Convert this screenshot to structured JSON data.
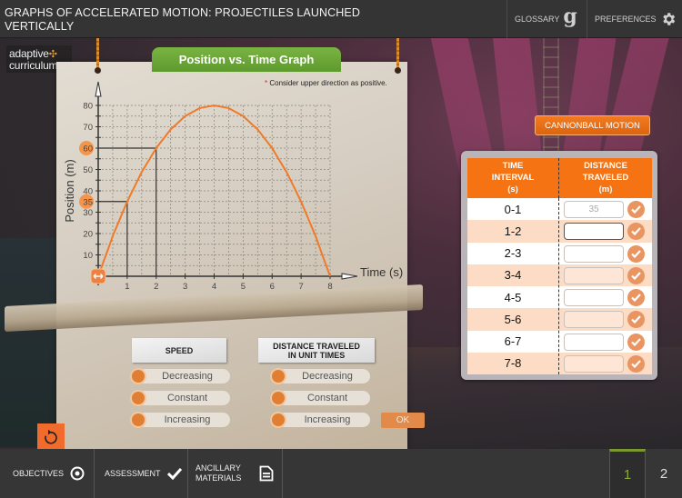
{
  "header": {
    "title_line1": "GRAPHS OF ACCELERATED MOTION: PROJECTILES LAUNCHED",
    "title_line2": "VERTICALLY",
    "glossary_label": "GLOSSARY",
    "glossary_glyph": "g",
    "preferences_label": "PREFERENCES"
  },
  "logo": {
    "line1": "adaptive",
    "line2": "curriculum"
  },
  "graph": {
    "banner": "Position vs. Time Graph",
    "note_star": "*",
    "note": "Consider upper direction as positive.",
    "highlighted_values": [
      "60",
      "35"
    ]
  },
  "chart_data": {
    "type": "line",
    "title": "Position vs. Time Graph",
    "xlabel": "Time (s)",
    "ylabel": "Position (m)",
    "xlim": [
      0,
      8
    ],
    "ylim": [
      0,
      80
    ],
    "x_ticks": [
      "1",
      "2",
      "3",
      "4",
      "5",
      "6",
      "7",
      "8"
    ],
    "y_ticks": [
      "10",
      "20",
      "30",
      "40",
      "50",
      "60",
      "70",
      "80"
    ],
    "grid": true,
    "series": [
      {
        "name": "position",
        "color": "#f07a28",
        "x": [
          0,
          0.5,
          1,
          1.5,
          2,
          2.5,
          3,
          3.5,
          4,
          4.5,
          5,
          5.5,
          6,
          6.5,
          7,
          7.5,
          8
        ],
        "y": [
          0,
          18.75,
          35,
          48.75,
          60,
          68.75,
          75,
          78.75,
          80,
          78.75,
          75,
          68.75,
          60,
          48.75,
          35,
          18.75,
          0
        ]
      }
    ],
    "guide_lines": [
      {
        "x": 1,
        "y": 35
      },
      {
        "x": 2,
        "y": 60
      }
    ]
  },
  "controls": {
    "cannonball_button": "CANNONBALL MOTION",
    "speed_tag": "SPEED",
    "distance_tag_line1": "DISTANCE TRAVELED",
    "distance_tag_line2": "IN UNIT TIMES",
    "speed_options": [
      "Decreasing",
      "Constant",
      "Increasing"
    ],
    "distance_options": [
      "Decreasing",
      "Constant",
      "Increasing"
    ],
    "ok_button": "OK"
  },
  "table": {
    "col1_line1": "TIME",
    "col1_line2": "INTERVAL",
    "col1_line3": "(s)",
    "col2_line1": "DISTANCE",
    "col2_line2": "TRAVELED",
    "col2_line3": "(m)",
    "rows": [
      {
        "interval": "0-1",
        "value": "35"
      },
      {
        "interval": "1-2",
        "value": ""
      },
      {
        "interval": "2-3",
        "value": ""
      },
      {
        "interval": "3-4",
        "value": ""
      },
      {
        "interval": "4-5",
        "value": ""
      },
      {
        "interval": "5-6",
        "value": ""
      },
      {
        "interval": "6-7",
        "value": ""
      },
      {
        "interval": "7-8",
        "value": ""
      }
    ]
  },
  "footer": {
    "objectives": "OBJECTIVES",
    "assessment": "ASSESSMENT",
    "ancillary_line1": "ANCILLARY",
    "ancillary_line2": "MATERIALS",
    "pages": [
      "1",
      "2"
    ],
    "current_page": "1"
  },
  "colors": {
    "accent_orange": "#f57312",
    "banner_green": "#6aa637",
    "active_page_green": "#8ca83a"
  }
}
